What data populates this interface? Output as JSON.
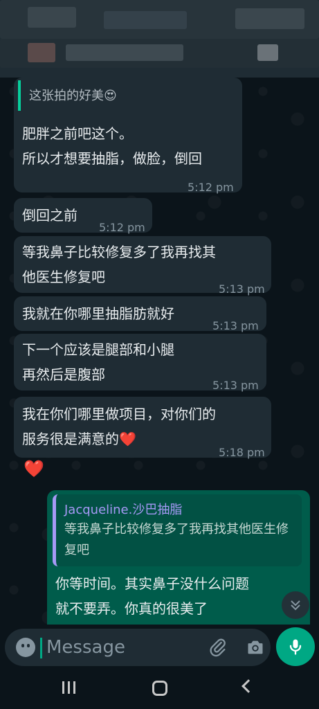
{
  "messages": {
    "m1": {
      "quote": "这张拍的好美😍",
      "line1": "肥胖之前吧这个。",
      "line2": "所以才想要抽脂，做脸，倒回",
      "time": "5:12 pm"
    },
    "m2": {
      "text": "倒回之前",
      "time": "5:12 pm"
    },
    "m3": {
      "line1": "等我鼻子比较修复多了我再找其",
      "line2": "他医生修复吧",
      "time": "5:13 pm"
    },
    "m4": {
      "text": "我就在你哪里抽脂肪就好",
      "time": "5:13 pm"
    },
    "m5": {
      "line1": "下一个应该是腿部和小腿",
      "line2": "再然后是腹部",
      "time": "5:13 pm"
    },
    "m6": {
      "line1": "我在你们哪里做项目，对你们的",
      "line2": "服务很是满意的❤️",
      "time": "5:18 pm"
    },
    "m7": {
      "text": "❤️"
    },
    "m8": {
      "quote_name": "Jacqueline.沙巴抽脂",
      "quote_text": "等我鼻子比较修复多了我再找其他医生修复吧",
      "line1": "你等时间。其实鼻子没什么问题",
      "line2": "就不要弄。你真的很美了"
    }
  },
  "input": {
    "placeholder": "Message"
  },
  "icons": {
    "emoji": "emoji-icon",
    "attach": "paperclip-icon",
    "camera": "camera-icon",
    "mic": "mic-icon",
    "scroll": "chevron-double-down-icon"
  },
  "colors": {
    "incoming_bubble": "#1f2c34",
    "outgoing_bubble": "#005c4b",
    "accent": "#00a884",
    "quote_name": "#a699f6",
    "background": "#0b141a"
  }
}
